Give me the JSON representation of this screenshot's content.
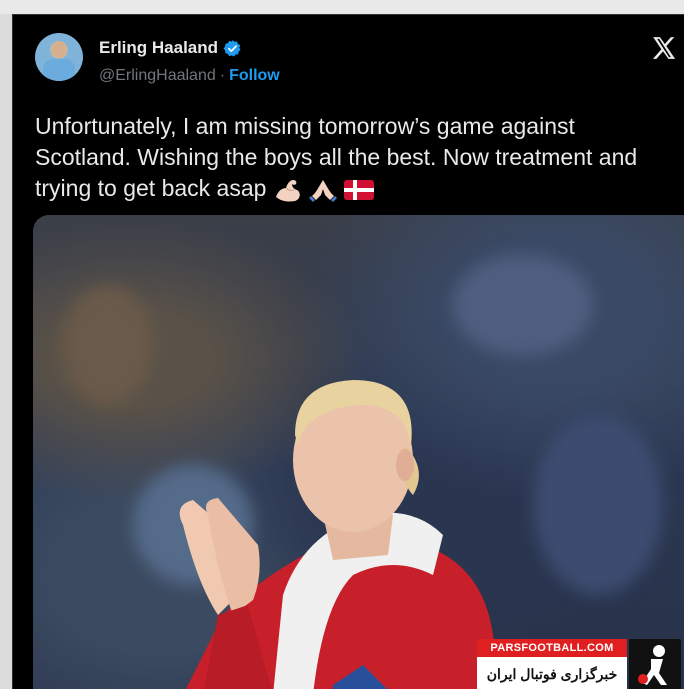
{
  "tweet": {
    "display_name": "Erling Haaland",
    "handle": "@ErlingHaaland",
    "separator": "·",
    "follow_label": "Follow",
    "text": "Unfortunately, I am missing tomorrow’s game against Scotland. Wishing the boys all the best. Now treatment and trying to get back asap",
    "emojis": [
      "flexed-biceps-icon",
      "folded-hands-icon",
      "denmark-flag-icon"
    ]
  },
  "watermark": {
    "site": "PARSFOOTBALL.COM",
    "persian_label": "خبرگزاری فوتبال ایران"
  },
  "colors": {
    "background": "#000000",
    "text": "#e7e9ea",
    "muted": "#71767b",
    "accent": "#1d9bf0",
    "watermark_red": "#e02020"
  }
}
